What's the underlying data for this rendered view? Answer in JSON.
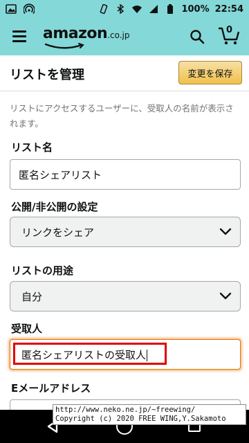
{
  "status_bar": {
    "battery": "100%",
    "time": "22:54",
    "icons": [
      "image-icon",
      "hotspot-icon",
      "vibrate-icon",
      "bluetooth-icon",
      "wifi-icon",
      "signal-icon",
      "battery-icon"
    ]
  },
  "header": {
    "logo_text": "amazon",
    "logo_domain": ".co.jp",
    "cart_count": "0",
    "background": "#84d8d8"
  },
  "page": {
    "title": "リストを管理",
    "save_label": "変更を保存",
    "description": "リストにアクセスするユーザーに、受取人の名前が表示されます。"
  },
  "form": {
    "list_name_label": "リスト名",
    "list_name_value": "匿名シェアリスト",
    "privacy_label": "公開/非公開の設定",
    "privacy_value": "リンクをシェア",
    "purpose_label": "リストの用途",
    "purpose_value": "自分",
    "recipient_label": "受取人",
    "recipient_value": "匿名シェアリストの受取人",
    "email_label": "Eメールアドレス"
  },
  "watermark": {
    "line1": "http://www.neko.ne.jp/~freewing/",
    "line2": "Copyright (c) 2020 FREE WING,Y.Sakamoto"
  },
  "colors": {
    "accent": "#f0c14b",
    "highlight": "#e00000",
    "focus": "#e77600"
  }
}
